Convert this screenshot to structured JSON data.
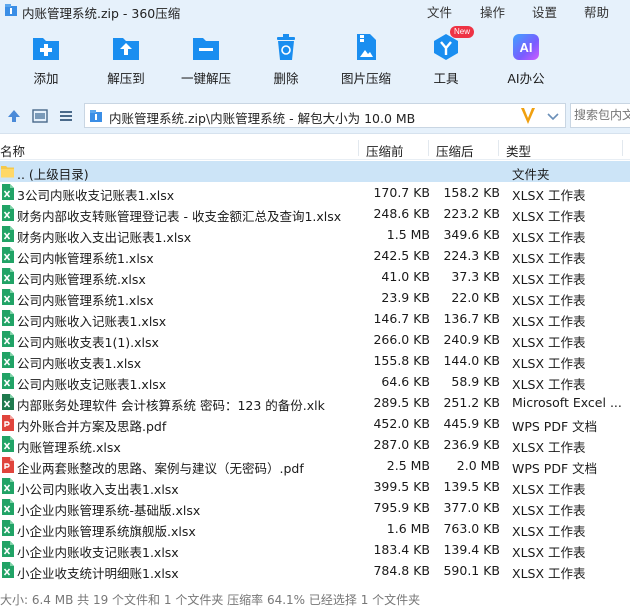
{
  "window": {
    "title": "内账管理系统.zip - 360压缩",
    "menu": [
      "文件",
      "操作",
      "设置",
      "帮助"
    ]
  },
  "toolbar": {
    "items": [
      {
        "label": "添加",
        "icon": "add-icon"
      },
      {
        "label": "解压到",
        "icon": "extract-to-icon"
      },
      {
        "label": "一键解压",
        "icon": "one-click-extract-icon"
      },
      {
        "label": "删除",
        "icon": "delete-icon"
      },
      {
        "label": "图片压缩",
        "icon": "image-compress-icon"
      },
      {
        "label": "工具",
        "icon": "tools-icon",
        "badge": "New"
      },
      {
        "label": "AI办公",
        "icon": "ai-office-icon",
        "icon_text": "AI"
      }
    ]
  },
  "address": {
    "path": "内账管理系统.zip\\内账管理系统 - 解包大小为 10.0 MB",
    "search_placeholder": "搜索包内文件"
  },
  "columns": {
    "name": "名称",
    "original": "压缩前",
    "compressed": "压缩后",
    "type": "类型"
  },
  "files": [
    {
      "name": ".. (上级目录)",
      "original": "",
      "compressed": "",
      "type": "文件夹",
      "kind": "folder"
    },
    {
      "name": "3公司内账收支记账表1.xlsx",
      "original": "170.7 KB",
      "compressed": "158.2 KB",
      "type": "XLSX 工作表",
      "kind": "xlsx"
    },
    {
      "name": "财务内部收支转账管理登记表 - 收支金额汇总及查询1.xlsx",
      "original": "248.6 KB",
      "compressed": "223.2 KB",
      "type": "XLSX 工作表",
      "kind": "xlsx"
    },
    {
      "name": "财务内账收入支出记账表1.xlsx",
      "original": "1.5 MB",
      "compressed": "349.6 KB",
      "type": "XLSX 工作表",
      "kind": "xlsx"
    },
    {
      "name": "公司内帐管理系统1.xlsx",
      "original": "242.5 KB",
      "compressed": "224.3 KB",
      "type": "XLSX 工作表",
      "kind": "xlsx"
    },
    {
      "name": "公司内账管理系统.xlsx",
      "original": "41.0 KB",
      "compressed": "37.3 KB",
      "type": "XLSX 工作表",
      "kind": "xlsx"
    },
    {
      "name": "公司内账管理系统1.xlsx",
      "original": "23.9 KB",
      "compressed": "22.0 KB",
      "type": "XLSX 工作表",
      "kind": "xlsx"
    },
    {
      "name": "公司内账收入记账表1.xlsx",
      "original": "146.7 KB",
      "compressed": "136.7 KB",
      "type": "XLSX 工作表",
      "kind": "xlsx"
    },
    {
      "name": "公司内账收支表1(1).xlsx",
      "original": "266.0 KB",
      "compressed": "240.9 KB",
      "type": "XLSX 工作表",
      "kind": "xlsx"
    },
    {
      "name": "公司内账收支表1.xlsx",
      "original": "155.8 KB",
      "compressed": "144.0 KB",
      "type": "XLSX 工作表",
      "kind": "xlsx"
    },
    {
      "name": "公司内账收支记账表1.xlsx",
      "original": "64.6 KB",
      "compressed": "58.9 KB",
      "type": "XLSX 工作表",
      "kind": "xlsx"
    },
    {
      "name": "内部账务处理软件 会计核算系统 密码：123 的备份.xlk",
      "original": "289.5 KB",
      "compressed": "251.2 KB",
      "type": "Microsoft Excel ...",
      "kind": "xlk"
    },
    {
      "name": "内外账合并方案及思路.pdf",
      "original": "452.0 KB",
      "compressed": "445.9 KB",
      "type": "WPS PDF 文档",
      "kind": "pdf"
    },
    {
      "name": "内账管理系统.xlsx",
      "original": "287.0 KB",
      "compressed": "236.9 KB",
      "type": "XLSX 工作表",
      "kind": "xlsx"
    },
    {
      "name": "企业两套账整改的思路、案例与建议（无密码）.pdf",
      "original": "2.5 MB",
      "compressed": "2.0 MB",
      "type": "WPS PDF 文档",
      "kind": "pdf"
    },
    {
      "name": "小公司内账收入支出表1.xlsx",
      "original": "399.5 KB",
      "compressed": "139.5 KB",
      "type": "XLSX 工作表",
      "kind": "xlsx"
    },
    {
      "name": "小企业内账管理系统-基础版.xlsx",
      "original": "795.9 KB",
      "compressed": "377.0 KB",
      "type": "XLSX 工作表",
      "kind": "xlsx"
    },
    {
      "name": "小企业内账管理系统旗舰版.xlsx",
      "original": "1.6 MB",
      "compressed": "763.0 KB",
      "type": "XLSX 工作表",
      "kind": "xlsx"
    },
    {
      "name": "小企业内账收支记账表1.xlsx",
      "original": "183.4 KB",
      "compressed": "139.4 KB",
      "type": "XLSX 工作表",
      "kind": "xlsx"
    },
    {
      "name": "小企业收支统计明细账1.xlsx",
      "original": "784.8 KB",
      "compressed": "590.1 KB",
      "type": "XLSX 工作表",
      "kind": "xlsx"
    }
  ],
  "status": {
    "text": "大小: 6.4 MB 共 19 个文件和 1 个文件夹 压缩率 64.1% 已经选择 1 个文件夹"
  },
  "colors": {
    "accent": "#1a8ef0",
    "toolbar_bg": "#e6f1fb",
    "selected_row": "#cce4f7",
    "xlsx_green": "#21a366",
    "pdf_red": "#e0443c",
    "folder_yellow": "#f5c94b",
    "badge_red": "#ee3344"
  }
}
